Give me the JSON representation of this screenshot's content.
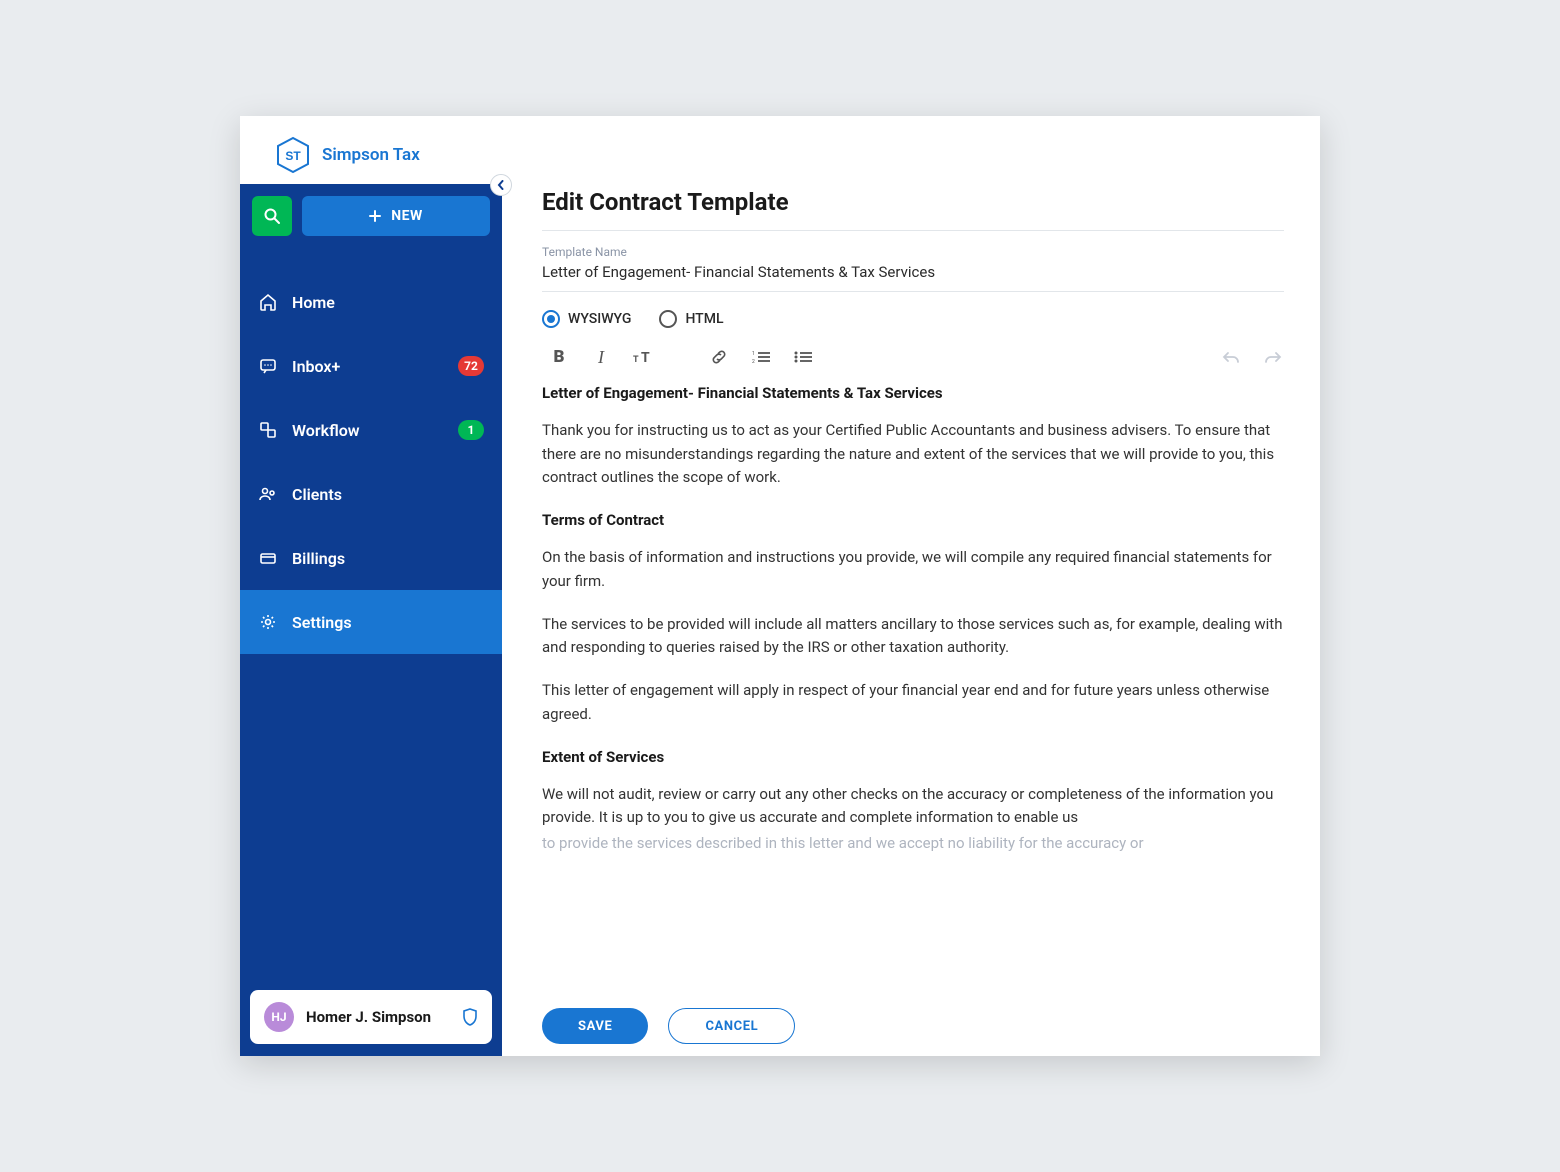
{
  "brand": {
    "code": "ST",
    "name": "Simpson Tax"
  },
  "sidebar": {
    "new_label": "NEW",
    "items": [
      {
        "label": "Home"
      },
      {
        "label": "Inbox+",
        "badge": "72"
      },
      {
        "label": "Workflow",
        "badge": "1"
      },
      {
        "label": "Clients"
      },
      {
        "label": "Billings"
      },
      {
        "label": "Settings"
      }
    ]
  },
  "user": {
    "initials": "HJ",
    "name": "Homer J. Simpson"
  },
  "page": {
    "title": "Edit Contract Template",
    "template_name_label": "Template Name",
    "template_name": "Letter of Engagement- Financial Statements & Tax Services",
    "mode_wysiwyg": "WYSIWYG",
    "mode_html": "HTML"
  },
  "doc": {
    "h1": "Letter of Engagement- Financial Statements & Tax Services",
    "p1": "Thank you for instructing us to act as your Certified Public Accountants and business advisers. To ensure that there are no misunderstandings regarding the nature and extent of the services that we will provide to you, this contract outlines the scope of work.",
    "h2": "Terms of Contract",
    "p2": "On the basis of information and instructions you provide, we will compile any required financial statements for your firm.",
    "p3": "The services to be provided will include all matters ancillary to those services such as, for example, dealing with and responding to queries raised by the IRS or other taxation authority.",
    "p4": "This letter of engagement will apply in respect of your financial year end and for future years unless otherwise agreed.",
    "h3": "Extent of Services",
    "p5a": "We will not audit, review or carry out any other checks on the accuracy or completeness of the information you provide. It is up to you to give us accurate and complete information to enable us",
    "p5b": "to provide the services described in this letter and we accept no liability for the accuracy or"
  },
  "actions": {
    "save": "SAVE",
    "cancel": "CANCEL"
  }
}
